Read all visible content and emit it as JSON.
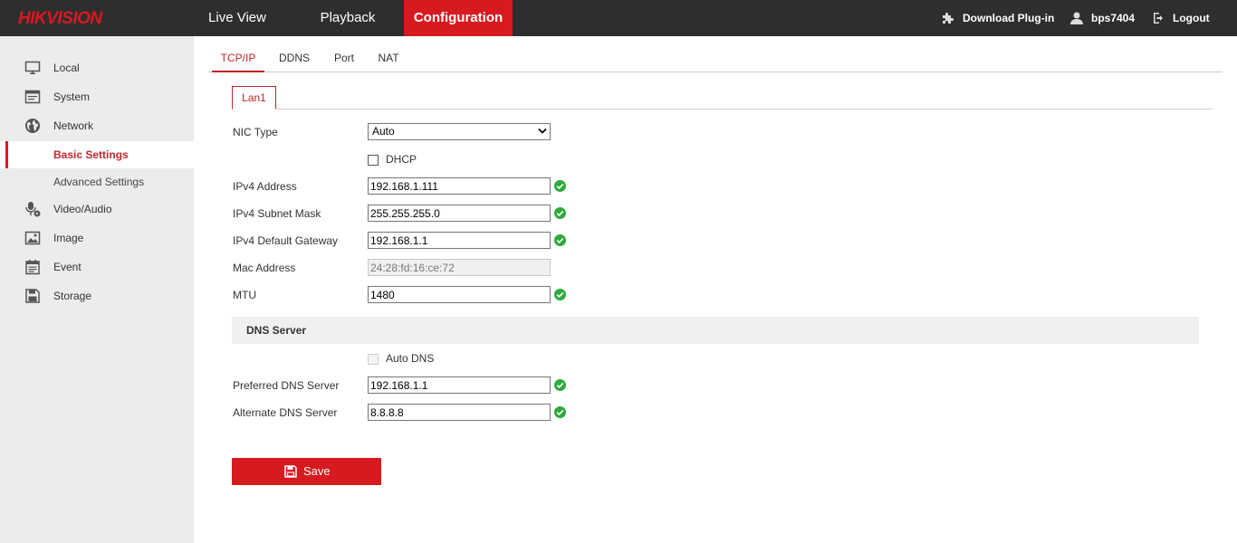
{
  "brand": {
    "logo_text": "HIKVISION"
  },
  "topnav": [
    {
      "label": "Live View"
    },
    {
      "label": "Playback"
    },
    {
      "label": "Configuration",
      "active": true
    }
  ],
  "topright": {
    "plugin": "Download Plug-in",
    "user": "bps7404",
    "logout": "Logout"
  },
  "sidebar": {
    "items": [
      {
        "label": "Local",
        "icon": "monitor-icon"
      },
      {
        "label": "System",
        "icon": "system-icon"
      },
      {
        "label": "Network",
        "icon": "globe-icon"
      },
      {
        "label": "Basic Settings",
        "sub": true,
        "active": true
      },
      {
        "label": "Advanced Settings",
        "sub": true
      },
      {
        "label": "Video/Audio",
        "icon": "microphone-icon"
      },
      {
        "label": "Image",
        "icon": "image-icon"
      },
      {
        "label": "Event",
        "icon": "event-icon"
      },
      {
        "label": "Storage",
        "icon": "storage-icon"
      }
    ]
  },
  "tabs": [
    {
      "label": "TCP/IP",
      "active": true
    },
    {
      "label": "DDNS"
    },
    {
      "label": "Port"
    },
    {
      "label": "NAT"
    }
  ],
  "subtab": {
    "label": "Lan1"
  },
  "form": {
    "nic_type": {
      "label": "NIC Type",
      "value": "Auto"
    },
    "dhcp": {
      "label": "DHCP",
      "checked": false
    },
    "ipv4_address": {
      "label": "IPv4 Address",
      "value": "192.168.1.111"
    },
    "ipv4_mask": {
      "label": "IPv4 Subnet Mask",
      "value": "255.255.255.0"
    },
    "ipv4_gateway": {
      "label": "IPv4 Default Gateway",
      "value": "192.168.1.1"
    },
    "mac": {
      "label": "Mac Address",
      "value": "24:28:fd:16:ce:72"
    },
    "mtu": {
      "label": "MTU",
      "value": "1480"
    }
  },
  "dns": {
    "section_title": "DNS Server",
    "auto_dns": {
      "label": "Auto DNS",
      "checked": false,
      "disabled": true
    },
    "preferred": {
      "label": "Preferred DNS Server",
      "value": "192.168.1.1"
    },
    "alternate": {
      "label": "Alternate DNS Server",
      "value": "8.8.8.8"
    }
  },
  "save_button": {
    "label": "Save"
  },
  "colors": {
    "accent": "#d71920",
    "topbar": "#2e2e2e",
    "sidebar": "#ececec",
    "valid": "#2eaa3c"
  }
}
